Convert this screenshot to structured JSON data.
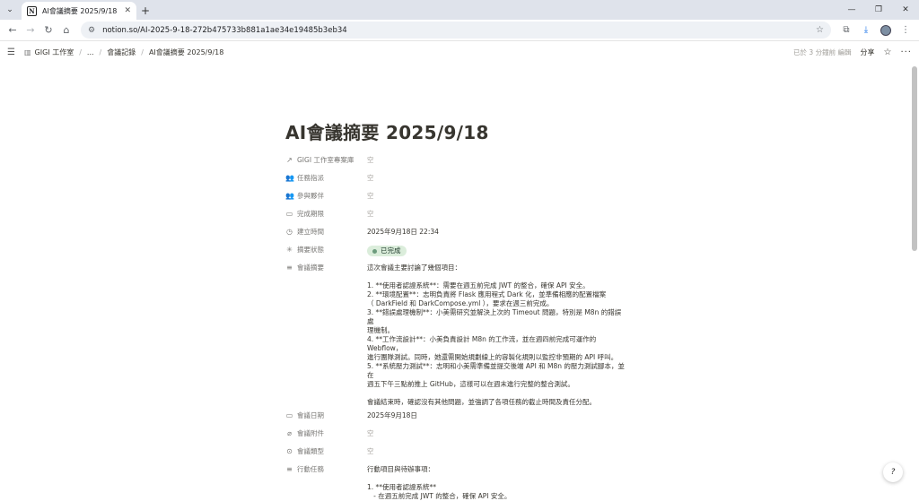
{
  "browser": {
    "tab_title": "AI會議摘要 2025/9/18",
    "tab_favicon": "N",
    "url": "notion.so/AI-2025-9-18-272b475733b881a1ae34e19485b3eb34"
  },
  "notion_bar": {
    "breadcrumbs": [
      "GIGI 工作室",
      "...",
      "會議記錄",
      "AI會議摘要 2025/9/18"
    ],
    "edited": "已於 3 分鐘前 編輯",
    "share": "分享"
  },
  "page": {
    "title": "AI會議摘要 2025/9/18",
    "properties": [
      {
        "icon": "arrow-up-right-icon",
        "glyph": "↗",
        "label": "GIGI 工作室專案庫",
        "value": "空",
        "empty": true
      },
      {
        "icon": "people-icon",
        "glyph": "👥",
        "label": "任務指派",
        "value": "空",
        "empty": true
      },
      {
        "icon": "people-icon",
        "glyph": "👥",
        "label": "參與夥伴",
        "value": "空",
        "empty": true
      },
      {
        "icon": "calendar-icon",
        "glyph": "▭",
        "label": "完成期限",
        "value": "空",
        "empty": true
      },
      {
        "icon": "clock-icon",
        "glyph": "◷",
        "label": "建立時間",
        "value": "2025年9月18日 22:34",
        "empty": false
      }
    ],
    "status": {
      "label": "摘要狀態",
      "value": "已完成",
      "color": "#dbeddb"
    },
    "summary": {
      "label": "會議摘要",
      "lines": [
        "這次會議主要討論了幾個項目：",
        "",
        "1. **使用者認證系統**：需要在週五前完成 JWT 的整合，確保 API 安全。",
        "2. **環境配置**：志明負責將 Flask 應用程式 Dark 化，並準備相應的配置檔案",
        "（ DarkField 和 DarkCompose.yml ），要求在週三前完成。",
        "3. **錯誤處理機制**：小美需研究並解決上次的 Timeout 問題，特別是 M8n 的錯誤處",
        "理機制。",
        "4. **工作流設計**：小美負責設計 M8n 的工作流，並在週四前完成可運作的 Webflow，",
        "進行團隊測試。同時，她還需開始規劃線上的容製化規則以監控非預期的 API 呼叫。",
        "5. **系統壓力測試**：志明和小美需準備並提交後端 API 和 M8n 的壓力測試腳本，並在",
        "週五下午三點前推上 GitHub，這樣可以在週末進行完整的整合測試。",
        "",
        "會議結束時，確認沒有其他問題，並強調了各項任務的截止時間及責任分配。"
      ]
    },
    "after_properties": [
      {
        "icon": "calendar-icon",
        "glyph": "▭",
        "label": "會議日期",
        "value": "2025年9月18日",
        "empty": false
      },
      {
        "icon": "paperclip-icon",
        "glyph": "⌀",
        "label": "會議附件",
        "value": "空",
        "empty": true
      },
      {
        "icon": "select-icon",
        "glyph": "⊙",
        "label": "會議類型",
        "value": "空",
        "empty": true
      }
    ],
    "actions": {
      "label": "行動任務",
      "lines": [
        "行動項目與待辦事項：",
        "",
        "1. **使用者認證系統**",
        "   - 在週五前完成 JWT 的整合，確保 API 安全。"
      ]
    }
  },
  "help_button": "?"
}
